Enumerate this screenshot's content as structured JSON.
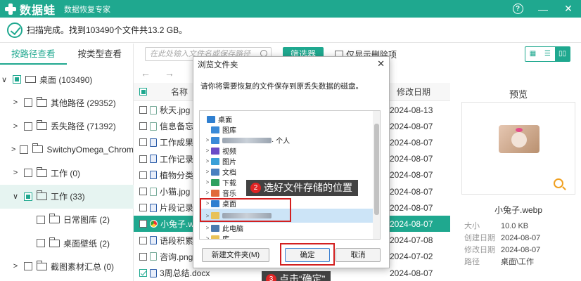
{
  "app": {
    "logo_text": "数据蛙",
    "subtitle": "数据恢复专家",
    "help_label": "?",
    "minimize_label": "—",
    "close_label": "✕"
  },
  "status": {
    "text": "扫描完成。找到103490个文件共13.2 GB。"
  },
  "left_tabs": {
    "by_path": "按路径查看",
    "by_type": "按类型查看"
  },
  "tree": [
    {
      "arrow": "∨",
      "icon": "drive",
      "label": "桌面 (103490)",
      "check": "partial"
    },
    {
      "arrow": ">",
      "icon": "folder",
      "label": "其他路径 (29352)",
      "check": "none"
    },
    {
      "arrow": ">",
      "icon": "folder",
      "label": "丢失路径 (71392)",
      "check": "none"
    },
    {
      "arrow": ">",
      "icon": "folder",
      "label": "SwitchyOmega_Chromium",
      "check": "none"
    },
    {
      "arrow": ">",
      "icon": "folder",
      "label": "工作 (0)",
      "check": "none"
    },
    {
      "arrow": "∨",
      "icon": "folder",
      "label": "工作 (33)",
      "check": "partial"
    },
    {
      "arrow": "",
      "icon": "folder",
      "label": "日常图库 (2)",
      "check": "none"
    },
    {
      "arrow": "",
      "icon": "folder",
      "label": "桌面壁纸 (2)",
      "check": "none"
    },
    {
      "arrow": ">",
      "icon": "folder",
      "label": "截图素材汇总 (0)",
      "check": "none"
    }
  ],
  "toolbar": {
    "search_placeholder": "在此处输入文件名或保存路径",
    "filter_label": "筛选器",
    "only_deleted_label": "仅显示删除项",
    "view_icons": [
      "▦",
      "☰",
      "▯▯"
    ]
  },
  "nav": {
    "back": "←",
    "forward": "→"
  },
  "table": {
    "name_header": "名称",
    "date_header": "修改日期",
    "rows": [
      {
        "name": "秋天.jpg",
        "date": "2024-08-13",
        "type": "img",
        "checked": false
      },
      {
        "name": "信息备忘.txt",
        "date": "2024-08-07",
        "type": "txt",
        "checked": false
      },
      {
        "name": "工作成果分析",
        "date": "2024-08-07",
        "type": "word",
        "checked": false
      },
      {
        "name": "工作记录表",
        "date": "2024-08-07",
        "type": "word",
        "checked": false
      },
      {
        "name": "植物分类.d",
        "date": "2024-08-07",
        "type": "word",
        "checked": false
      },
      {
        "name": "小猫.jpg",
        "date": "2024-08-07",
        "type": "img",
        "checked": false
      },
      {
        "name": "片段记录.do",
        "date": "2024-08-07",
        "type": "word",
        "checked": false
      },
      {
        "name": "小兔子.web",
        "date": "2024-08-07",
        "type": "chrome",
        "checked": false,
        "selected": true
      },
      {
        "name": "语段积累.do",
        "date": "2024-07-08",
        "type": "word",
        "checked": false
      },
      {
        "name": "咨询.png",
        "date": "2024-07-02",
        "type": "img",
        "checked": false
      },
      {
        "name": "3周总结.docx",
        "date": "2024-08-07",
        "type": "word",
        "checked": true
      }
    ]
  },
  "preview": {
    "title": "预览",
    "filename": "小兔子.webp",
    "meta": [
      {
        "key": "大小",
        "value": "10.0 KB"
      },
      {
        "key": "创建日期",
        "value": "2024-08-07"
      },
      {
        "key": "修改日期",
        "value": "2024-08-07"
      },
      {
        "key": "路径",
        "value": "桌面\\工作"
      }
    ]
  },
  "dialog": {
    "title": "浏览文件夹",
    "close": "✕",
    "description": "请你将需要恢复的文件保存到原丢失数据的磁盘。",
    "tree": [
      {
        "label": "桌面",
        "indent": 0,
        "twisty": "",
        "color": "#2f7fd0"
      },
      {
        "label": "图库",
        "indent": 1,
        "twisty": "",
        "color": "#3a8ad8"
      },
      {
        "label": "· 个人",
        "indent": 1,
        "twisty": ">",
        "color": "#3a8ad8",
        "blur": true
      },
      {
        "label": "视频",
        "indent": 1,
        "twisty": ">",
        "color": "#6a4cc8"
      },
      {
        "label": "图片",
        "indent": 1,
        "twisty": ">",
        "color": "#3aa0d8"
      },
      {
        "label": "文档",
        "indent": 1,
        "twisty": ">",
        "color": "#4a80c0"
      },
      {
        "label": "下载",
        "indent": 1,
        "twisty": ">",
        "color": "#2fa060"
      },
      {
        "label": "音乐",
        "indent": 1,
        "twisty": ">",
        "color": "#e06a3a"
      },
      {
        "label": "桌面",
        "indent": 1,
        "twisty": ">",
        "color": "#2f7fd0"
      },
      {
        "label": "",
        "indent": 1,
        "twisty": ">",
        "color": "#e8c25a",
        "blur": true,
        "selected": true
      },
      {
        "label": "此电脑",
        "indent": 1,
        "twisty": ">",
        "color": "#4a7ab0"
      },
      {
        "label": "库",
        "indent": 1,
        "twisty": ">",
        "color": "#e8c25a"
      }
    ],
    "new_folder": "新建文件夹(M)",
    "ok": "确定",
    "cancel": "取消"
  },
  "callouts": {
    "step2_num": "2",
    "step2_text": "选好文件存储的位置",
    "step3_num": "3",
    "step3_text": "点击“确定”"
  }
}
